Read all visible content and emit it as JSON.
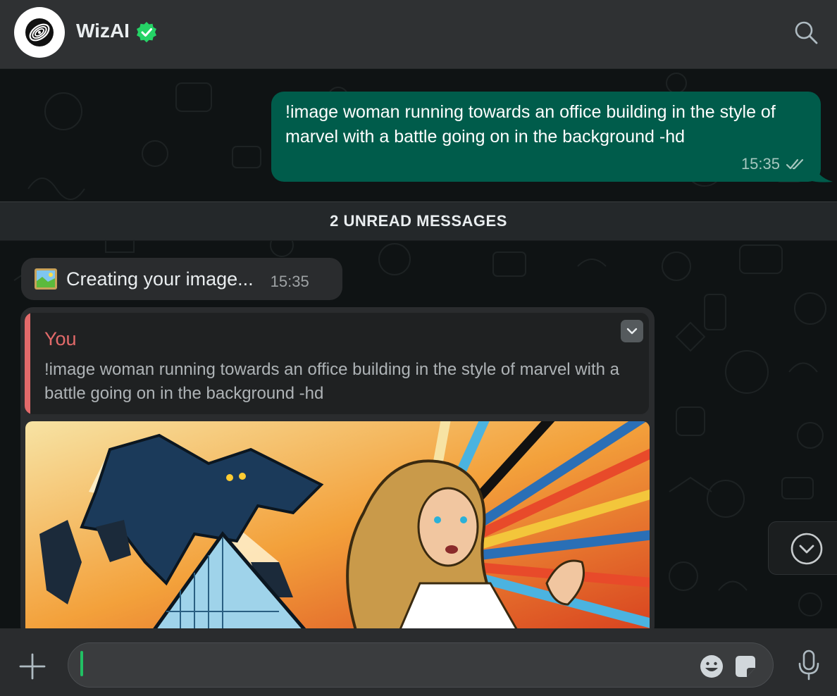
{
  "header": {
    "title": "WizAI",
    "avatar_icon": "wizai-logo-icon",
    "verified_icon": "verified-badge-icon",
    "search_icon": "search-icon"
  },
  "messages": {
    "outgoing": {
      "text": "!image woman running towards an office building in the style of marvel with a battle going on in the background -hd",
      "time": "15:35",
      "status_icon": "double-check-icon"
    },
    "unread_divider": "2 UNREAD MESSAGES",
    "creating": {
      "emoji_icon": "framed-picture-emoji",
      "text": "Creating your image...",
      "time": "15:35"
    },
    "image_reply": {
      "quote_author": "You",
      "quote_text": "!image woman running towards an office building in the style of marvel with a battle going on in the background -hd",
      "menu_icon": "chevron-down-icon",
      "image_description_icon": "generated-comic-image"
    }
  },
  "scroll_down_icon": "scroll-down-icon",
  "composer": {
    "attach_icon": "plus-icon",
    "input_value": "",
    "emoji_icon": "emoji-icon",
    "sticker_icon": "sticker-icon",
    "mic_icon": "mic-icon"
  },
  "colors": {
    "header_bg": "#2f3133",
    "outgoing_bubble": "#005c4b",
    "incoming_bubble": "#2a2c2e",
    "quote_accent": "#e26a6a",
    "verified_green": "#25d366",
    "cursor_green": "#21c063"
  }
}
